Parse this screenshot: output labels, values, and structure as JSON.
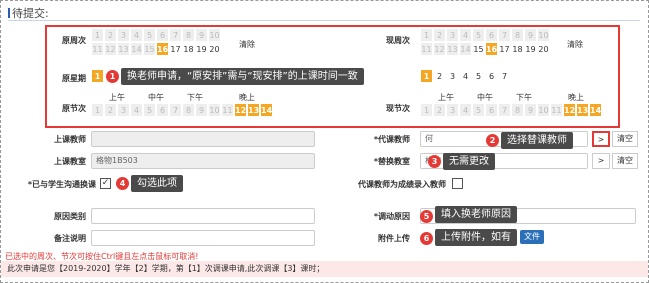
{
  "section_title": "待提交:",
  "labels": {
    "orig_week": "原周次",
    "orig_weekday": "原星期",
    "orig_period": "原节次",
    "new_week": "现周次",
    "new_period": "现节次",
    "teacher": "上课教师",
    "classroom": "上课教室",
    "notified": "*已与学生沟通换课",
    "reason_type": "原因类别",
    "remark": "备注说明",
    "sub_teacher": "*代课教师",
    "new_classroom": "*替换教室",
    "record_as_teacher": "代课教师为成绩录入教师",
    "change_reason": "*调动原因",
    "attachment": "附件上传"
  },
  "clear_label": "清除",
  "weeks_row1": [
    "1",
    "2",
    "3",
    "4",
    "5",
    "6",
    "7",
    "8",
    "9",
    "10"
  ],
  "weeks_row2": [
    "11",
    "12",
    "13",
    "14",
    "15",
    "16",
    "17",
    "18",
    "19",
    "20"
  ],
  "orig_week_selected": "16",
  "new_week_selected": "16",
  "weekdays": [
    "1",
    "2",
    "3",
    "4",
    "5",
    "6",
    "7"
  ],
  "period_groups": [
    "上午",
    "中午",
    "下午",
    "晚上"
  ],
  "periods": [
    "1",
    "2",
    "3",
    "4",
    "5",
    "6",
    "7",
    "8",
    "9",
    "10",
    "11",
    "12",
    "13",
    "14"
  ],
  "selected_periods": [
    "12",
    "13",
    "14"
  ],
  "teacher_value": "",
  "classroom_value": "格物1B503",
  "sub_teacher_value": "何",
  "new_classroom_value": "格物",
  "select_btn": ">",
  "clear_btn": "清空",
  "checkmark": "✓",
  "upload_label": "文件",
  "callouts": {
    "c1": "换老师申请，“原安排”需与“现安排”的上课时间一致",
    "c2": "选择替课教师",
    "c3": "无需更改",
    "c4": "勾选此项",
    "c5": "填入换老师原因",
    "c6": "上传附件，如有"
  },
  "badges": [
    "1",
    "2",
    "3",
    "4",
    "5",
    "6"
  ],
  "hint": "已选中的周次、节次可按住Ctrl键且左点击鼠标可取消!",
  "bottom": {
    "pre": "此次申请是您【2019-2020】学年【2】学期，第【1】次调课申请,此次调课【3】课时；"
  }
}
